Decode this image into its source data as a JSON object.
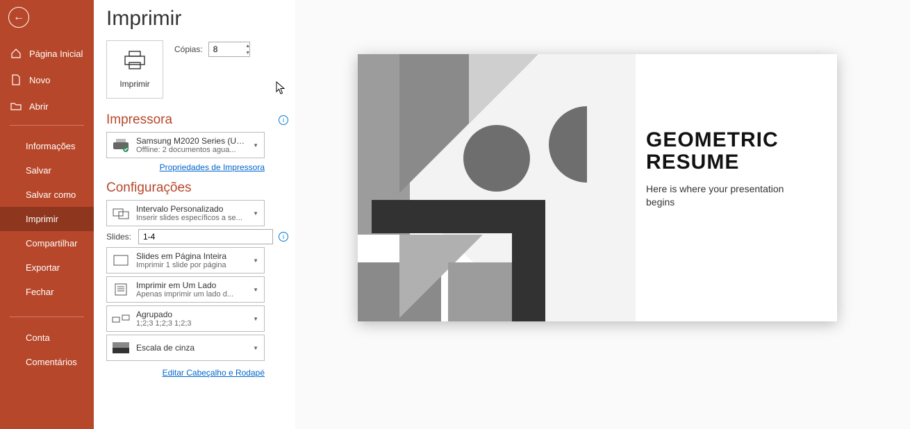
{
  "sidebar": {
    "back": "←",
    "items": {
      "home": "Página Inicial",
      "new": "Novo",
      "open": "Abrir",
      "info": "Informações",
      "save": "Salvar",
      "saveas": "Salvar como",
      "print": "Imprimir",
      "share": "Compartilhar",
      "export": "Exportar",
      "close": "Fechar",
      "account": "Conta",
      "feedback": "Comentários"
    }
  },
  "page": {
    "title": "Imprimir"
  },
  "print_button": {
    "label": "Imprimir"
  },
  "copies": {
    "label": "Cópias:",
    "value": "8"
  },
  "printer_section": {
    "title": "Impressora"
  },
  "printer": {
    "name": "Samsung M2020 Series (USB...",
    "status": "Offline: 2 documentos agua..."
  },
  "printer_props_link": "Propriedades de Impressora",
  "settings_section": {
    "title": "Configurações"
  },
  "settings": {
    "range": {
      "t1": "Intervalo Personalizado",
      "t2": "Inserir slides específicos a se..."
    },
    "slides_label": "Slides:",
    "slides_value": "1-4",
    "layout": {
      "t1": "Slides em Página Inteira",
      "t2": "Imprimir 1 slide por página"
    },
    "sides": {
      "t1": "Imprimir em Um Lado",
      "t2": "Apenas imprimir um lado d..."
    },
    "collate": {
      "t1": "Agrupado",
      "t2": "1;2;3    1;2;3    1;2;3"
    },
    "color": {
      "t1": "Escala de cinza"
    },
    "edit_header_link": "Editar Cabeçalho e Rodapé"
  },
  "slide": {
    "title1": "GEOMETRIC",
    "title2": "RESUME",
    "subtitle": "Here is where your presentation  begins"
  }
}
